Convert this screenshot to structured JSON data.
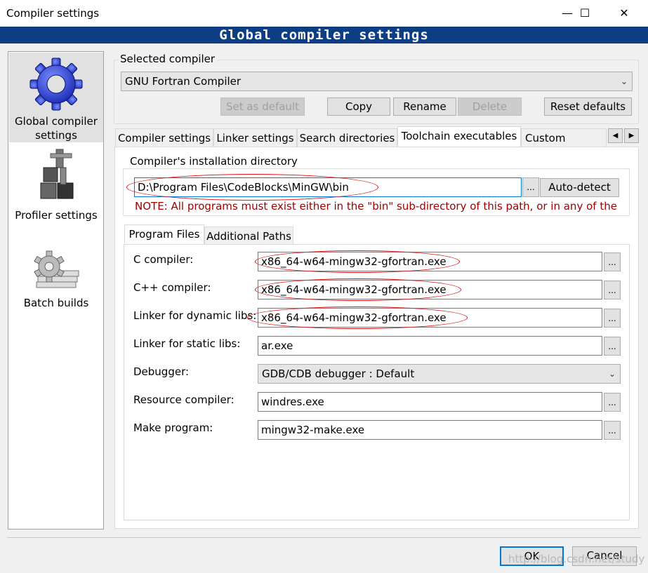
{
  "window": {
    "title": "Compiler settings",
    "minimize": "—",
    "maximize": "☐",
    "close": "✕"
  },
  "banner": "Global compiler settings",
  "sidebar": {
    "items": [
      {
        "label_line1": "Global compiler",
        "label_line2": "settings",
        "icon": "gear-icon"
      },
      {
        "label": "Profiler settings",
        "icon": "caliper-icon"
      },
      {
        "label": "Batch builds",
        "icon": "batch-gear-icon"
      }
    ]
  },
  "selected_compiler": {
    "label": "Selected compiler",
    "value": "GNU Fortran Compiler"
  },
  "compiler_buttons": {
    "set_default": "Set as default",
    "copy": "Copy",
    "rename": "Rename",
    "delete": "Delete",
    "reset": "Reset defaults"
  },
  "tabs": [
    "Compiler settings",
    "Linker settings",
    "Search directories",
    "Toolchain executables",
    "Custom variable"
  ],
  "tab_scroll": {
    "left": "◀",
    "right": "▶"
  },
  "install_dir": {
    "label": "Compiler's installation directory",
    "value": "D:\\Program Files\\CodeBlocks\\MinGW\\bin",
    "browse": "...",
    "autodetect": "Auto-detect",
    "note": "NOTE: All programs must exist either in the \"bin\" sub-directory of this path, or in any of the"
  },
  "subtabs": [
    "Program Files",
    "Additional Paths"
  ],
  "programs": [
    {
      "label": "C compiler:",
      "value": "x86_64-w64-mingw32-gfortran.exe"
    },
    {
      "label": "C++ compiler:",
      "value": "x86_64-w64-mingw32-gfortran.exe"
    },
    {
      "label": "Linker for dynamic libs:",
      "value": "x86_64-w64-mingw32-gfortran.exe"
    },
    {
      "label": "Linker for static libs:",
      "value": "ar.exe"
    },
    {
      "label": "Debugger:",
      "value": "GDB/CDB debugger : Default"
    },
    {
      "label": "Resource compiler:",
      "value": "windres.exe"
    },
    {
      "label": "Make program:",
      "value": "mingw32-make.exe"
    }
  ],
  "browse_label": "...",
  "footer": {
    "ok": "OK",
    "cancel": "Cancel",
    "watermark": "http://blog.csdn.net/study"
  },
  "colors": {
    "banner": "#0d3d82",
    "annotation": "#dd1111",
    "note": "#a00000"
  }
}
